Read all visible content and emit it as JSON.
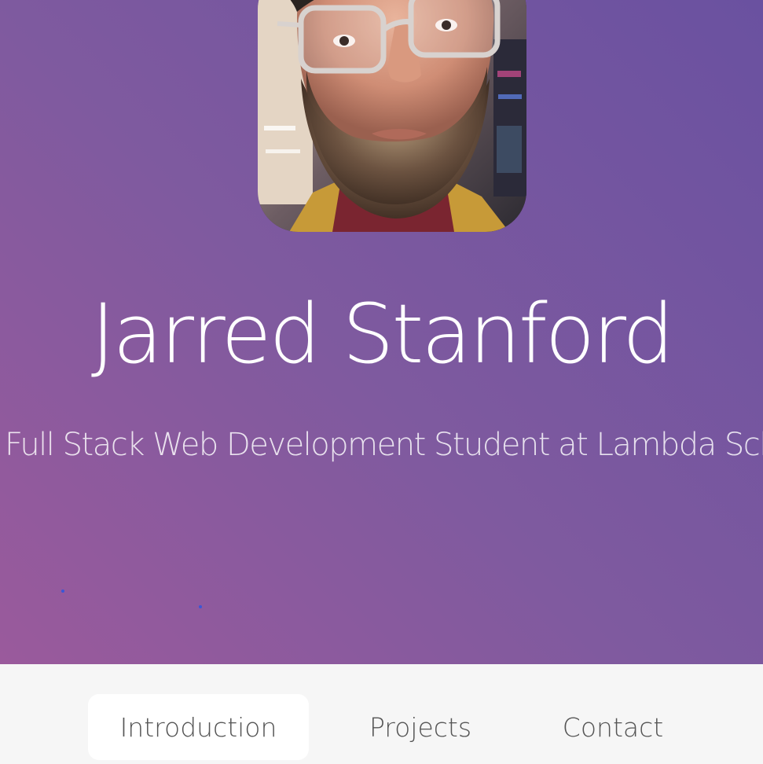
{
  "profile": {
    "name": "Jarred Stanford",
    "tagline": "Full Stack Web Development Student at Lambda School",
    "photo_alt": "avatar-photo"
  },
  "nav": {
    "tabs": [
      {
        "label": "Introduction",
        "active": true
      },
      {
        "label": "Projects",
        "active": false
      },
      {
        "label": "Contact",
        "active": false
      }
    ]
  },
  "colors": {
    "hero_gradient_start": "#9a5a9c",
    "hero_gradient_end": "#6a51a0",
    "nav_background": "#f6f6f6",
    "active_tab": "#ffffff",
    "particle": "#3b56d6"
  }
}
